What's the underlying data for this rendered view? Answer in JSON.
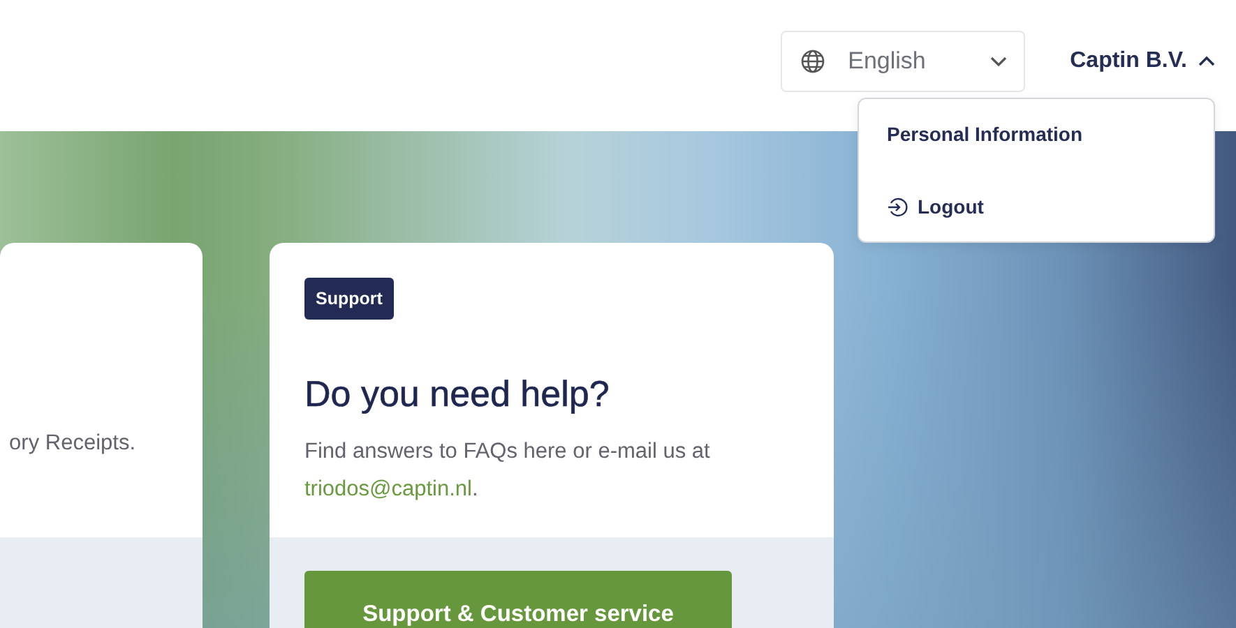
{
  "header": {
    "language": {
      "value": "English"
    },
    "account": {
      "name": "Captin B.V.",
      "expanded": true
    }
  },
  "account_menu": [
    {
      "label": "Personal Information",
      "kind": "link"
    },
    {
      "label": "Logout",
      "kind": "action"
    }
  ],
  "cards": [
    {
      "kind": "partial",
      "text": "ory Receipts."
    },
    {
      "kind": "support",
      "badge": "Support",
      "title": "Do you need help?",
      "text": "Find answers to FAQs here or e-mail us at",
      "email": "triodos@captin.nl",
      "text_end": ".",
      "button": "Support & Customer service"
    }
  ]
}
